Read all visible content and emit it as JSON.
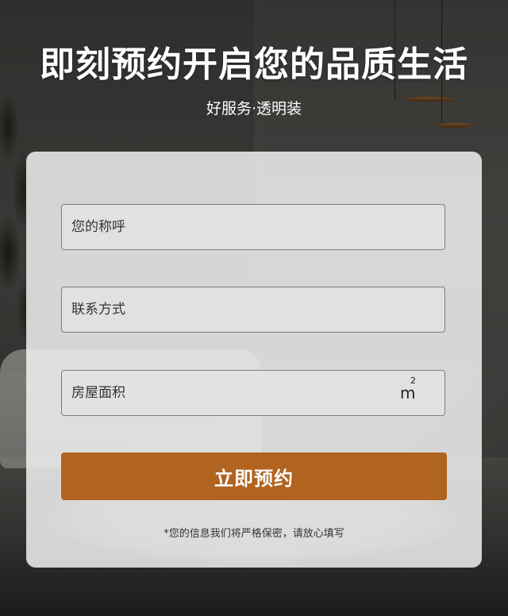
{
  "header": {
    "title": "即刻预约开启您的品质生活",
    "subtitle": "好服务·透明装"
  },
  "form": {
    "name_placeholder": "您的称呼",
    "phone_placeholder": "联系方式",
    "area_placeholder": "房屋面积",
    "area_unit_base": "m",
    "area_unit_exp": "2",
    "submit_label": "立即预约",
    "privacy_note": "*您的信息我们将严格保密，请放心填写"
  },
  "colors": {
    "accent": "#b06420",
    "title_text": "#ffffff",
    "card_background": "#f0f0f0"
  }
}
